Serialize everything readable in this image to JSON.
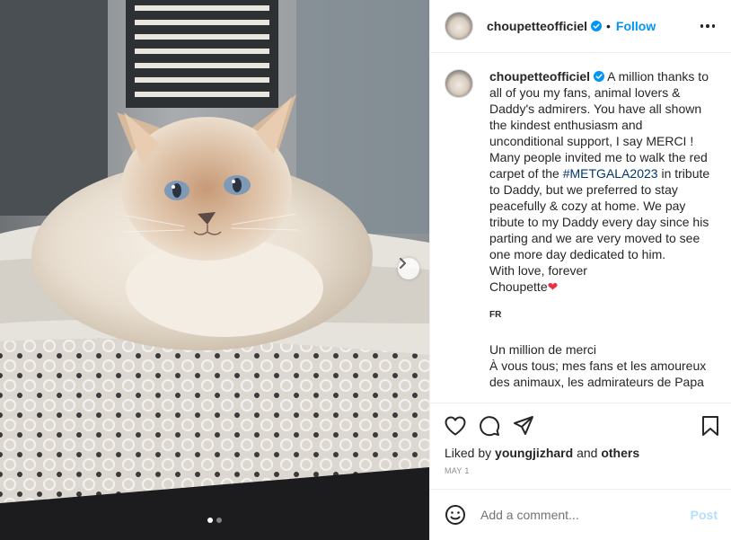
{
  "post": {
    "username": "choupetteofficiel",
    "separator": "•",
    "follow_label": "Follow"
  },
  "caption": {
    "username": "choupetteofficiel",
    "text_1": "A million thanks to all of you my fans, animal lovers & Daddy's admirers. You have all shown the kindest enthusiasm and unconditional support, I say MERCI ! Many people invited me to walk the red carpet of the",
    "hashtag": "#METGALA2023",
    "text_2": "in tribute to Daddy, but we preferred to stay peacefully & cozy at home. We pay tribute to my Daddy every day since his parting and we are very moved to see one more day dedicated to him.",
    "line_love": "With love, forever",
    "line_sign": "Choupette",
    "heart": "❤",
    "lang_label": "FR",
    "fr_line_1": "Un million de merci",
    "fr_line_2": "À vous tous; mes fans et les amoureux des animaux, les admirateurs de Papa"
  },
  "actions": {
    "liked_prefix": "Liked by",
    "liked_user": "youngjizhard",
    "liked_and": "and",
    "liked_others": "others",
    "date": "MAY 1"
  },
  "comment": {
    "placeholder": "Add a comment...",
    "post_label": "Post"
  },
  "icons": {
    "next": "chevron-right-icon",
    "like": "heart-outline-icon",
    "comment": "speech-bubble-icon",
    "share": "paper-plane-icon",
    "save": "bookmark-icon",
    "emoji": "smiley-icon",
    "more": "ellipsis-icon",
    "verified": "verified-badge-icon"
  },
  "carousel": {
    "total": 2,
    "active": 1
  },
  "colors": {
    "accent": "#0095f6",
    "hashtag": "#00376b",
    "post_disabled": "#b2dffc",
    "heart": "#ed2f47"
  }
}
